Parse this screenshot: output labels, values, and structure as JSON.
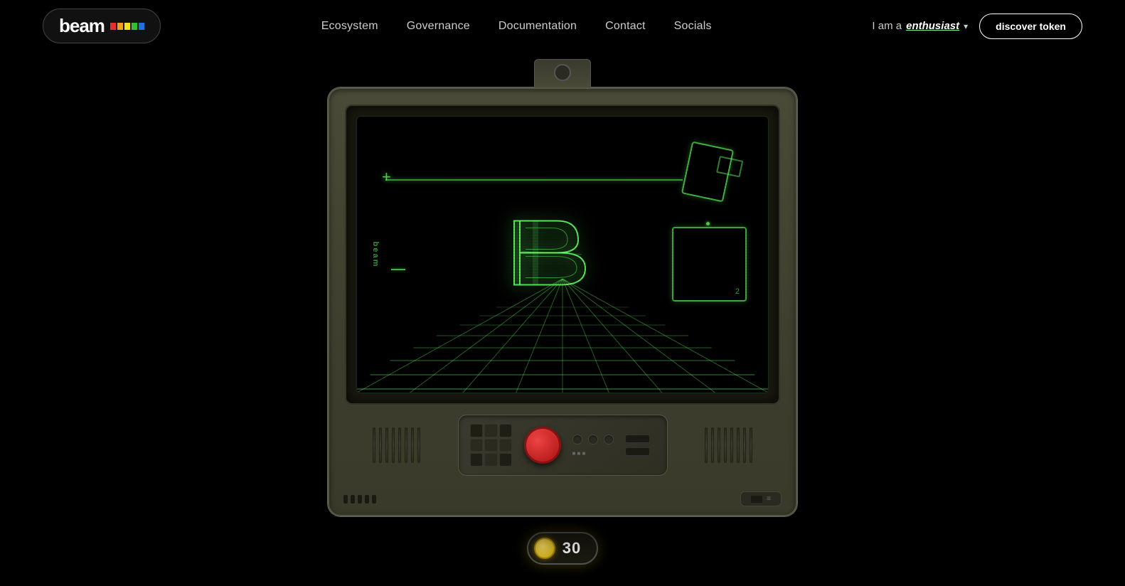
{
  "nav": {
    "logo_text": "beam",
    "links": [
      {
        "label": "Ecosystem",
        "href": "#"
      },
      {
        "label": "Governance",
        "href": "#"
      },
      {
        "label": "Documentation",
        "href": "#"
      },
      {
        "label": "Contact",
        "href": "#"
      },
      {
        "label": "Socials",
        "href": "#"
      }
    ],
    "role_prefix": "I am a",
    "role_bold": "enthusiast",
    "discover_btn": "discover token"
  },
  "screen": {
    "logo_vertical": "beam",
    "center_logo": "B"
  },
  "score": {
    "number": "30"
  },
  "colors": {
    "green_glow": "#64ff64",
    "bg": "#000000",
    "console_body": "#4a4a38",
    "red_btn": "#cc1111",
    "coin": "#ffdd44"
  }
}
